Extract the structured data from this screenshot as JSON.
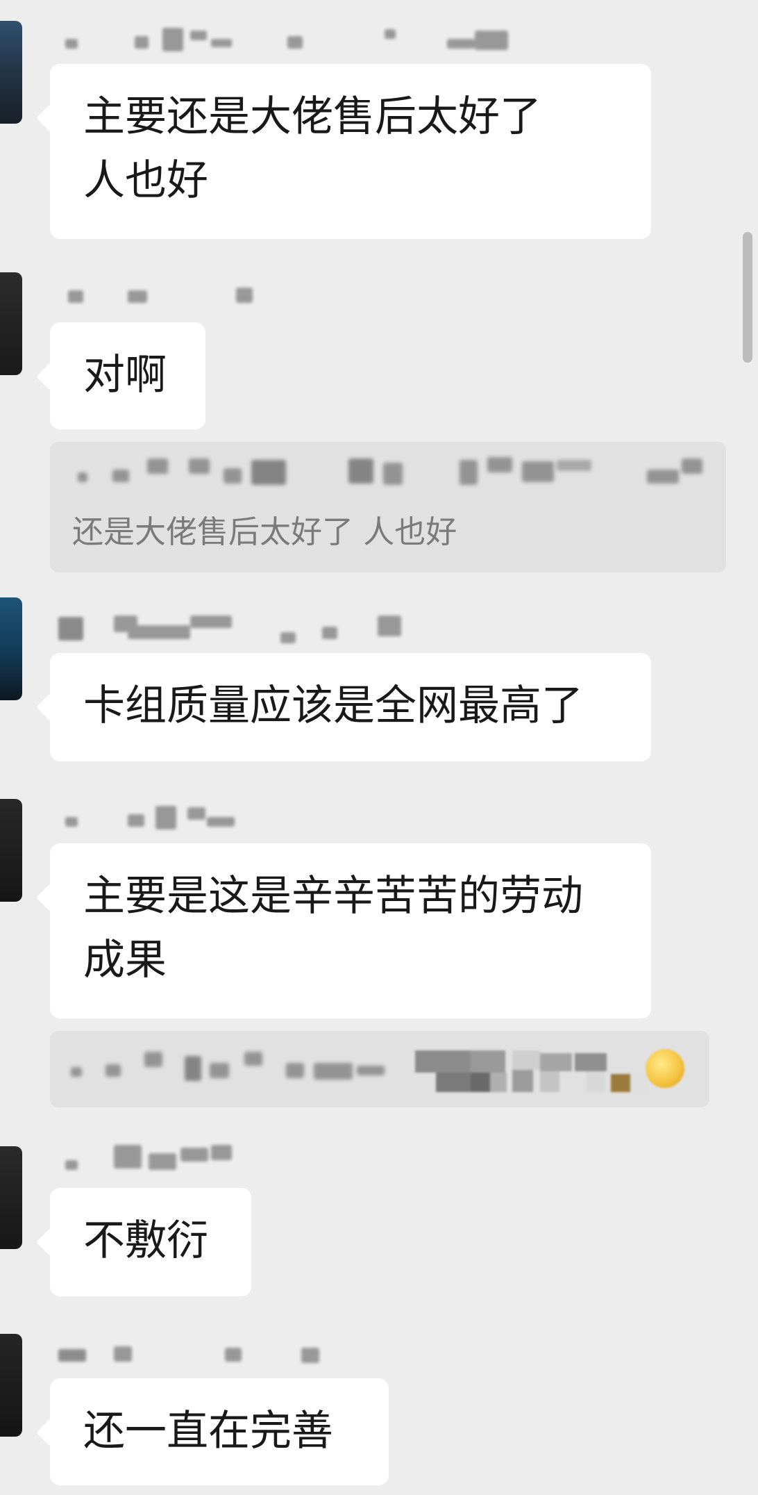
{
  "messages": [
    {
      "text_lines": [
        "主要还是大佬售后太好了",
        "人也好"
      ]
    },
    {
      "text_lines": [
        "对啊"
      ]
    },
    {
      "quote_text": "还是大佬售后太好了 人也好"
    },
    {
      "text_lines": [
        "卡组质量应该是全网最高了"
      ]
    },
    {
      "text_lines": [
        "主要是这是辛辛苦苦的劳动",
        "成果"
      ]
    },
    {
      "text_lines": [
        "不敷衍"
      ]
    },
    {
      "text_lines": [
        "还一直在完善"
      ]
    }
  ],
  "colors": {
    "background": "#ededed",
    "bubble": "#ffffff",
    "quote_background": "#e1e1e1",
    "text": "#191919",
    "quote_text": "#7a7a7a"
  }
}
